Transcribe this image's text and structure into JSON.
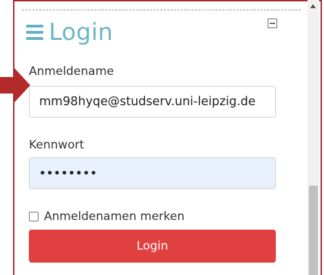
{
  "login_block": {
    "title": "Login",
    "username_label": "Anmeldename",
    "username_value": "mm98hyqe@studserv.uni-leipzig.de",
    "password_label": "Kennwort",
    "password_value": "••••••••",
    "remember_label": "Anmeldenamen merken",
    "remember_checked": false,
    "login_button": "Login"
  },
  "icons": {
    "menu": "hamburger-menu-icon",
    "collapse": "collapse-block-icon",
    "pointer": "arrow-right-icon",
    "scroll_up": "scroll-up-arrow-icon"
  },
  "colors": {
    "heading": "#6bb6c8",
    "button": "#e0403f",
    "frame": "#a5242a",
    "pointer_arrow": "#b22a2a",
    "password_field_bg": "#e8f0fe"
  }
}
